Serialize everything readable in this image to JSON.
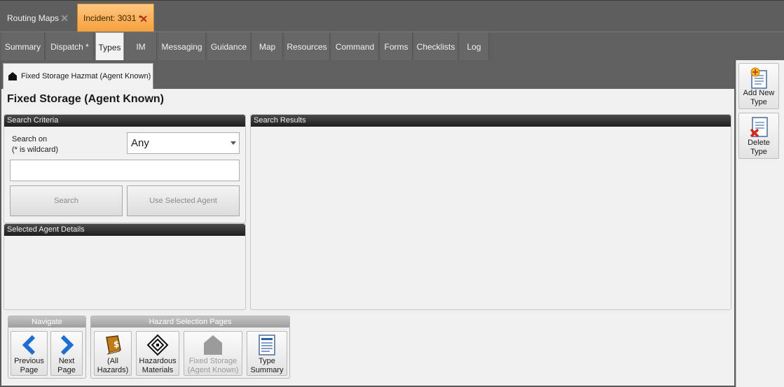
{
  "doc_tabs": [
    {
      "label": "Routing Maps"
    },
    {
      "label": "Incident: 3031 *"
    }
  ],
  "nav_tabs": [
    "Summary",
    "Dispatch *",
    "Types",
    "IM",
    "Messaging",
    "Guidance",
    "Map",
    "Resources",
    "Command",
    "Forms",
    "Checklists",
    "Log"
  ],
  "sub_tab": {
    "label": "Fixed Storage Hazmat (Agent Known)"
  },
  "page_title": "Fixed Storage (Agent Known)",
  "search_criteria": {
    "header": "Search Criteria",
    "search_on_label": "Search on",
    "wildcard_hint": "(* is wildcard)",
    "search_on_value": "Any",
    "search_value": "",
    "search_button": "Search",
    "use_agent_button": "Use Selected Agent"
  },
  "selected_agent": {
    "header": "Selected Agent Details"
  },
  "search_results": {
    "header": "Search Results"
  },
  "navigate": {
    "header": "Navigate",
    "previous": [
      "Previous",
      "Page"
    ],
    "next": [
      "Next",
      "Page"
    ]
  },
  "hazard_pages": {
    "header": "Hazard Selection Pages",
    "all": [
      "(All",
      "Hazards)"
    ],
    "hazmat": [
      "Hazardous",
      "Materials"
    ],
    "fixed": [
      "Fixed Storage",
      "(Agent Known)"
    ],
    "summary": [
      "Type",
      "Summary"
    ]
  },
  "rail": {
    "add": [
      "Add New",
      "Type"
    ],
    "delete": [
      "Delete",
      "Type"
    ]
  },
  "colors": {
    "active_doc_tab": "#f6a03a",
    "panel_header": "#1e1e1e",
    "nav_arrow": "#1f6fd0"
  }
}
